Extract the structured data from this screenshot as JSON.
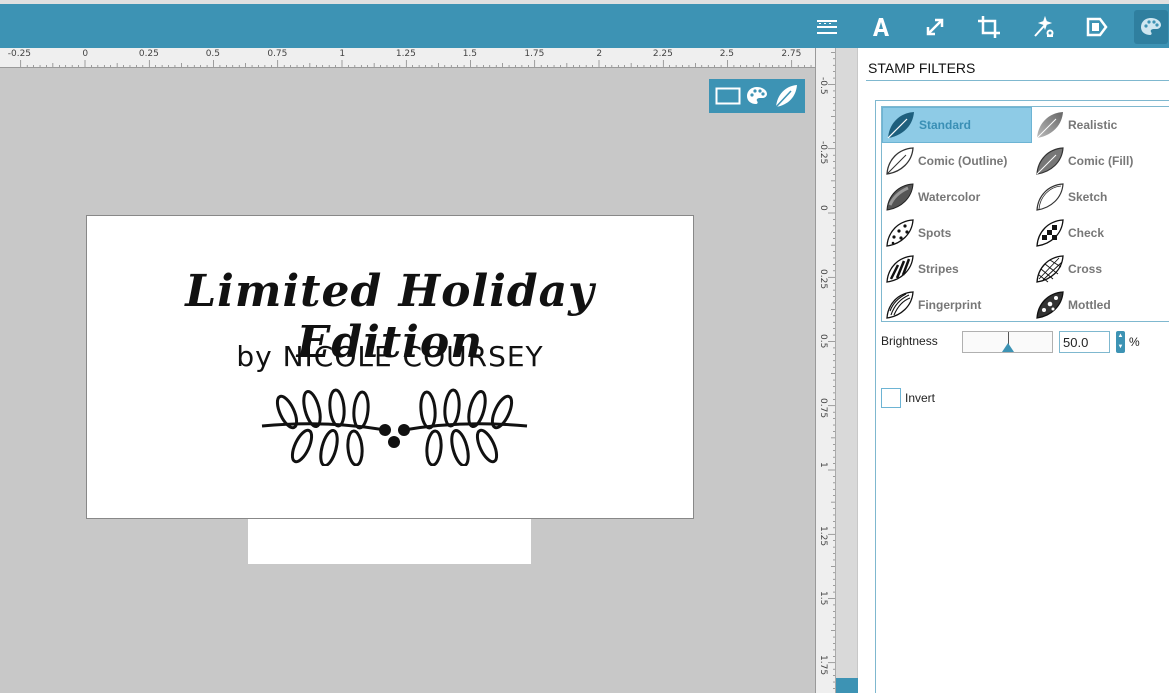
{
  "toolbar": {
    "icons": [
      "lines-menu-icon",
      "text-icon",
      "resize-arrows-icon",
      "crop-icon",
      "magic-wand-icon",
      "stamp-tag-icon",
      "palette-icon"
    ],
    "accent": "#3d93b4"
  },
  "ruler_h": {
    "labels": [
      "-0.25",
      "0",
      "0.25",
      "0.5",
      "0.75",
      "1",
      "1.25",
      "1.5",
      "1.75",
      "2",
      "2.25",
      "2.5",
      "2.75"
    ]
  },
  "ruler_v": {
    "labels": [
      "-0.5",
      "-0.25",
      "0",
      "0.25",
      "0.5",
      "0.75",
      "1",
      "1.25",
      "1.5",
      "1.75"
    ]
  },
  "canvas": {
    "stamp_title": "Limited Holiday  Edition",
    "stamp_subtitle": "by NICOLE COURSEY"
  },
  "mini_tools": [
    "rectangle-icon",
    "palette-icon",
    "leaf-icon"
  ],
  "panel": {
    "title": "STAMP FILTERS",
    "filters": [
      {
        "label": "Standard",
        "icon": "leaf-solid-icon",
        "selected": true
      },
      {
        "label": "Realistic",
        "icon": "leaf-gradient-icon",
        "selected": false
      },
      {
        "label": "Comic (Outline)",
        "icon": "leaf-outline-icon",
        "selected": false
      },
      {
        "label": "Comic (Fill)",
        "icon": "leaf-fill-icon",
        "selected": false
      },
      {
        "label": "Watercolor",
        "icon": "leaf-watercolor-icon",
        "selected": false
      },
      {
        "label": "Sketch",
        "icon": "leaf-sketch-icon",
        "selected": false
      },
      {
        "label": "Spots",
        "icon": "leaf-spots-icon",
        "selected": false
      },
      {
        "label": "Check",
        "icon": "leaf-check-icon",
        "selected": false
      },
      {
        "label": "Stripes",
        "icon": "leaf-stripes-icon",
        "selected": false
      },
      {
        "label": "Cross",
        "icon": "leaf-cross-icon",
        "selected": false
      },
      {
        "label": "Fingerprint",
        "icon": "leaf-fingerprint-icon",
        "selected": false
      },
      {
        "label": "Mottled",
        "icon": "leaf-mottled-icon",
        "selected": false
      }
    ],
    "brightness_label": "Brightness",
    "brightness_value": "50.0",
    "brightness_fraction": 0.5,
    "brightness_unit": "%",
    "invert_label": "Invert",
    "invert_checked": false
  }
}
